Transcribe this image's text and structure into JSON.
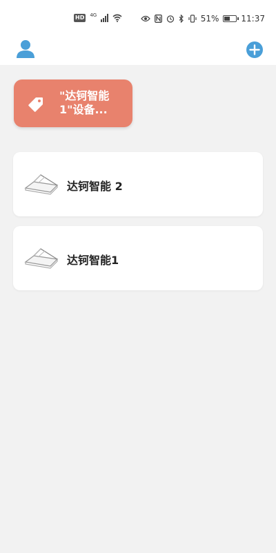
{
  "status_bar": {
    "left_icons": [
      "hd-icon",
      "4g-signal-icon",
      "wifi-icon"
    ],
    "hd_text": "HD",
    "network": "4G",
    "right_icons": [
      "eye-icon",
      "nfc-icon",
      "alarm-icon",
      "bluetooth-icon",
      "vibrate-icon"
    ],
    "battery_percent": "51%",
    "time": "11:37"
  },
  "header": {
    "user_icon": "user-icon",
    "add_icon": "plus-circle-icon",
    "accent_color": "#4a9fd8"
  },
  "tag_card": {
    "icon": "tag-icon",
    "label": "\"达钶智能1\"设备...",
    "color": "#e8826d"
  },
  "devices": [
    {
      "name": "达钶智能 2",
      "icon": "window-device-icon"
    },
    {
      "name": "达钶智能1",
      "icon": "window-device-icon"
    }
  ]
}
